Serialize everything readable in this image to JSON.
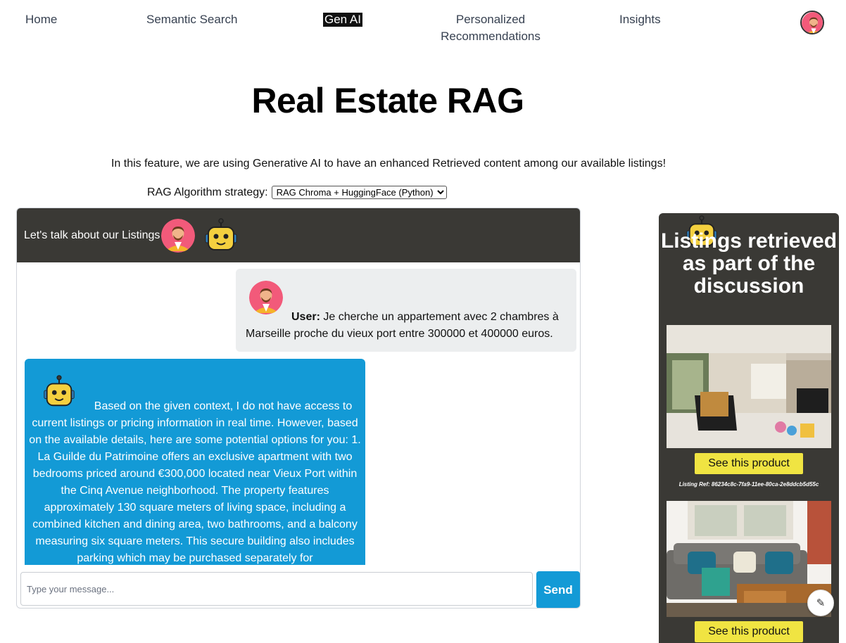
{
  "nav": {
    "home": "Home",
    "semantic_search": "Semantic Search",
    "gen_ai": "Gen AI",
    "personalized": "Personalized Recommendations",
    "insights": "Insights"
  },
  "page": {
    "title": "Real Estate RAG",
    "intro": "In this feature, we are using Generative AI to have an enhanced Retrieved content among our available listings!",
    "strategy_label": "RAG Algorithm strategy:",
    "strategy_selected": "RAG Chroma + HuggingFace (Python)"
  },
  "chat": {
    "header": "Let's talk about our Listings",
    "user_label": "User:",
    "user_line1": "Je cherche un appartement avec 2 chambres à",
    "user_line2": "Marseille proche du vieux port entre 300000 et 400000 euros.",
    "bot_message": "Based on the given context, I do not have access to current listings or pricing information in real time. However, based on the available details, here are some potential options for you: 1. La Guilde du Patrimoine offers an exclusive apartment with two bedrooms priced around €300,000 located near Vieux Port within the Cinq Avenue neighborhood. The property features approximately 130 square meters of living space, including a combined kitchen and dining area, two bathrooms, and a balcony measuring six square meters. This secure building also includes parking which may be purchased separately for",
    "input_placeholder": "Type your message...",
    "send_label": "Send"
  },
  "side": {
    "title": "Listings retrieved as part of the discussion",
    "listings": [
      {
        "button": "See this product",
        "ref": "Listing Ref: 86234c8c-7fa9-11ee-80ca-2e8ddcb5d55c"
      },
      {
        "button": "See this product"
      }
    ]
  },
  "colors": {
    "dark_panel": "#3a3935",
    "accent_blue": "#139ad6",
    "user_bubble": "#eceeef",
    "product_button": "#f0e442"
  },
  "icons": [
    "user-avatar-icon",
    "robot-icon",
    "pencil-icon"
  ]
}
